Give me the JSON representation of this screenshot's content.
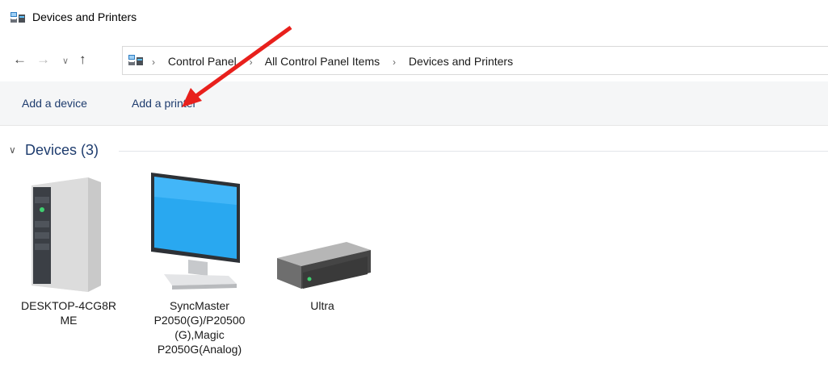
{
  "window": {
    "title": "Devices and Printers",
    "icon": "devices-printers-icon"
  },
  "navigation": {
    "back": "←",
    "forward": "→",
    "recent": "∨",
    "up": "↑",
    "breadcrumbs": [
      "Control Panel",
      "All Control Panel Items",
      "Devices and Printers"
    ],
    "separator": "›"
  },
  "commands": {
    "add_device": "Add a device",
    "add_printer": "Add a printer"
  },
  "group": {
    "chevron": "∨",
    "label": "Devices (3)"
  },
  "devices": [
    {
      "label": "DESKTOP-4CG8R\nME",
      "icon": "computer-tower-icon"
    },
    {
      "label": "SyncMaster\nP2050(G)/P20500\n(G),Magic\nP2050G(Analog)",
      "icon": "monitor-icon"
    },
    {
      "label": "Ultra",
      "icon": "external-drive-icon"
    }
  ],
  "annotation": {
    "color": "#e8201c",
    "shape": "arrow",
    "points_to": "add-printer-button"
  }
}
